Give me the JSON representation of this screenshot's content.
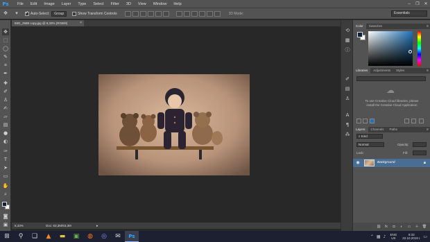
{
  "app": {
    "logo": "Ps"
  },
  "menu": [
    "File",
    "Edit",
    "Image",
    "Layer",
    "Type",
    "Select",
    "Filter",
    "3D",
    "View",
    "Window",
    "Help"
  ],
  "window_controls": [
    "–",
    "❐",
    "✕"
  ],
  "options_bar": {
    "auto_select_label": "Auto-Select:",
    "auto_select_target": "Group",
    "show_transform_label": "Show Transform Controls",
    "mode_3d_label": "3D Mode:",
    "workspace": "Essentials"
  },
  "document": {
    "tab_title": "IMG_2588 copy.jpg @ 8,33% (RGB/8)",
    "tab_close": "×"
  },
  "status": {
    "zoom": "8,33%",
    "doc_info": "Doc: 63,3M/63,3M",
    "arrow": "▸"
  },
  "color_panel": {
    "tabs": [
      "Color",
      "Swatches"
    ],
    "foreground": "#0c2238",
    "background": "#ffffff"
  },
  "libraries_panel": {
    "tabs": [
      "Libraries",
      "Adjustments",
      "Styles"
    ],
    "message": "To use Creative Cloud libraries, please install the Creative Cloud Application"
  },
  "layers_panel": {
    "tabs": [
      "Layers",
      "Channels",
      "Paths"
    ],
    "filter_kind": "Kind",
    "blend_mode": "Normal",
    "opacity_label": "Opacity:",
    "lock_label": "Lock:",
    "fill_label": "Fill:",
    "layer_name": "Background"
  },
  "taskbar": {
    "lang_top": "ENG",
    "lang_bottom": "US",
    "time": "9:33",
    "date": "22.10.2019 г."
  },
  "colors": {
    "accent": "#31a8ff",
    "selected_layer": "#4a6d94"
  }
}
